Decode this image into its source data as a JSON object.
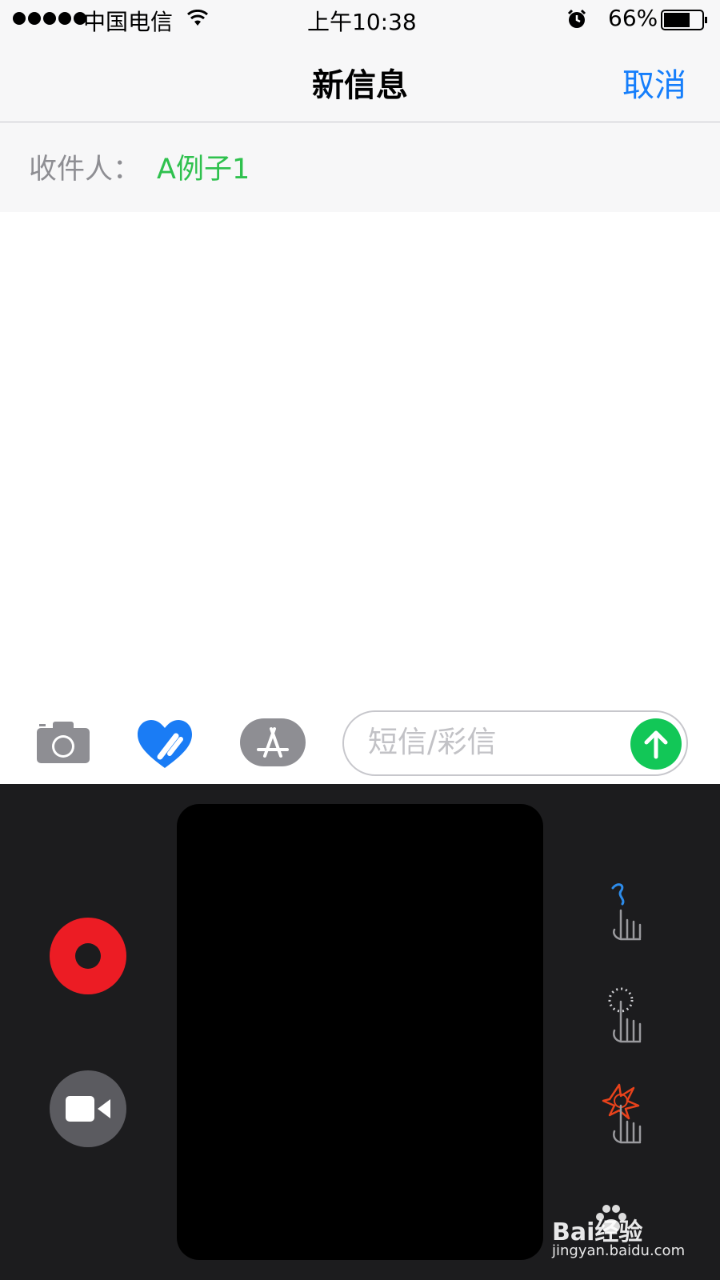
{
  "status_bar": {
    "carrier": "中国电信",
    "time": "上午10:38",
    "battery": "66%",
    "icons": [
      "signal-dots",
      "wifi-icon",
      "alarm-icon",
      "battery-icon"
    ]
  },
  "nav": {
    "title": "新信息",
    "cancel": "取消"
  },
  "recipient": {
    "label": "收件人：",
    "name": "A例子1"
  },
  "toolbar": {
    "icons": [
      "camera-icon",
      "digital-touch-heart-icon",
      "app-store-icon"
    ],
    "message_placeholder": "短信/彩信",
    "send_icon": "arrow-up-icon"
  },
  "digital_touch": {
    "buttons": [
      "record-button",
      "video-button"
    ],
    "gestures": [
      "tap-draw-gesture-icon",
      "tap-gesture-icon",
      "fireball-gesture-icon"
    ]
  },
  "watermark": {
    "brand": "Bai经验",
    "url": "jingyan.baidu.com"
  },
  "colors": {
    "accent_blue": "#157efb",
    "recipient_green": "#2fc14e",
    "send_green": "#12c757",
    "record_red": "#ec1c24",
    "panel_bg": "#1c1c1e"
  }
}
